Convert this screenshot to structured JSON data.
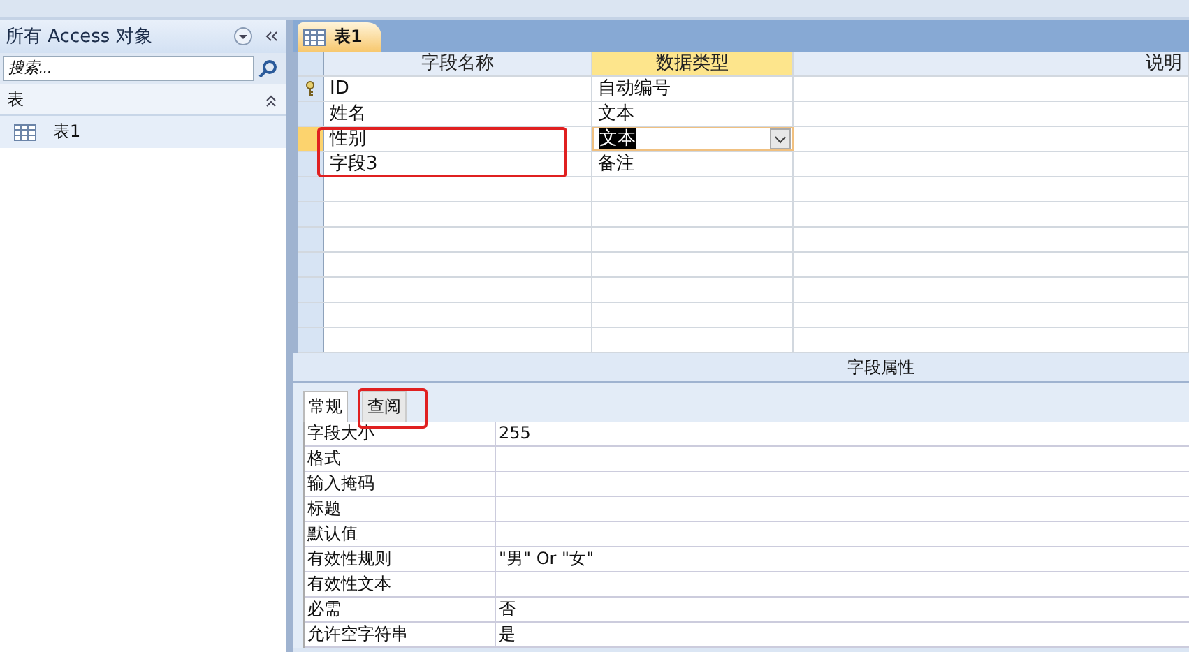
{
  "nav_pane": {
    "title": "所有 Access 对象",
    "search": {
      "placeholder": "搜索..."
    },
    "sections": [
      {
        "label": "表",
        "expanded": true,
        "items": [
          {
            "label": "表1",
            "selected": false
          }
        ]
      }
    ]
  },
  "document_tab": {
    "label": "表1",
    "selected": true
  },
  "design_grid": {
    "columns": [
      "字段名称",
      "数据类型",
      "说明"
    ],
    "rows": [
      {
        "name": "ID",
        "type": "自动编号",
        "primary_key": true,
        "selected": false
      },
      {
        "name": "姓名",
        "type": "文本",
        "primary_key": false,
        "selected": false
      },
      {
        "name": "性别",
        "type": "文本",
        "primary_key": false,
        "selected": true
      },
      {
        "name": "字段3",
        "type": "备注",
        "primary_key": false,
        "selected": false
      }
    ]
  },
  "field_properties": {
    "title": "字段属性",
    "tabs": [
      {
        "label": "常规",
        "selected": true
      },
      {
        "label": "查阅",
        "selected": false
      }
    ],
    "rows": [
      {
        "label": "字段大小",
        "value": "255"
      },
      {
        "label": "格式",
        "value": ""
      },
      {
        "label": "输入掩码",
        "value": ""
      },
      {
        "label": "标题",
        "value": ""
      },
      {
        "label": "默认值",
        "value": ""
      },
      {
        "label": "有效性规则",
        "value": "\"男\" Or \"女\""
      },
      {
        "label": "有效性文本",
        "value": ""
      },
      {
        "label": "必需",
        "value": "否"
      },
      {
        "label": "允许空字符串",
        "value": "是"
      }
    ]
  }
}
